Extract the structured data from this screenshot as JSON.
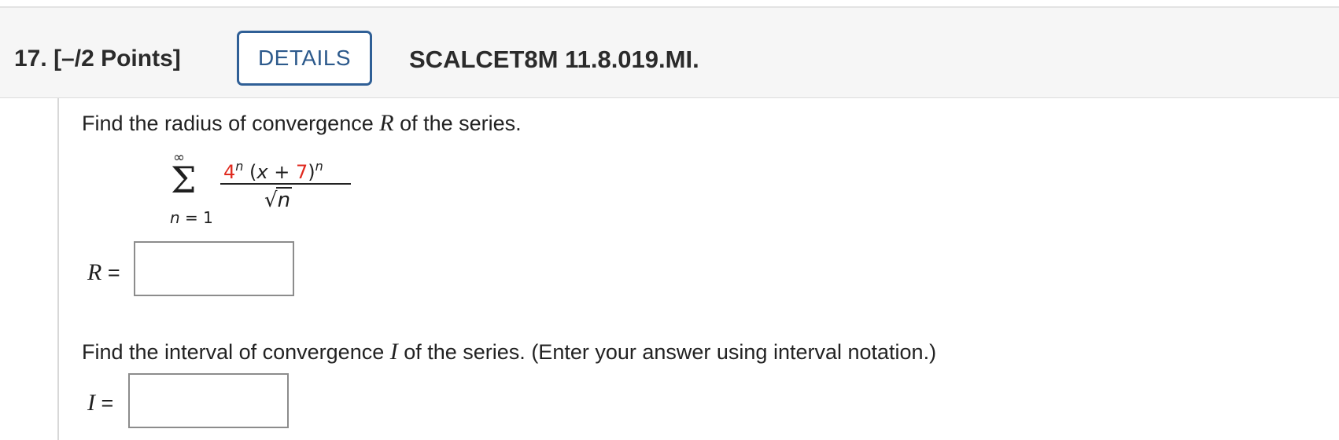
{
  "header": {
    "question_number": "17.",
    "points": "[–/2 Points]",
    "details_label": "DETAILS",
    "problem_id": "SCALCET8M 11.8.019.MI."
  },
  "part1": {
    "prompt_before": "Find the radius of convergence ",
    "variable": "R",
    "prompt_after": " of the series.",
    "answer_label_var": "R",
    "answer_label_eq": " =",
    "answer_value": ""
  },
  "formula": {
    "sum_upper": "∞",
    "sum_symbol": "Σ",
    "sum_index_var": "n",
    "sum_index_rest": " = 1",
    "numerator_base": "4",
    "numerator_exp": "n",
    "open_paren": " (",
    "x_var": "x",
    "plus": " + ",
    "constant": "7",
    "close_paren": ")",
    "paren_exp": "n",
    "radical": "√",
    "radicand": "n"
  },
  "part2": {
    "prompt_before": "Find the interval of convergence ",
    "variable": "I",
    "prompt_after": " of the series. (Enter your answer using interval notation.)",
    "answer_label_var": "I",
    "answer_label_eq": " =",
    "answer_value": ""
  },
  "colors": {
    "accent": "#2d5a8c",
    "highlight_red": "#e02b20",
    "header_bg": "#f6f6f6"
  }
}
